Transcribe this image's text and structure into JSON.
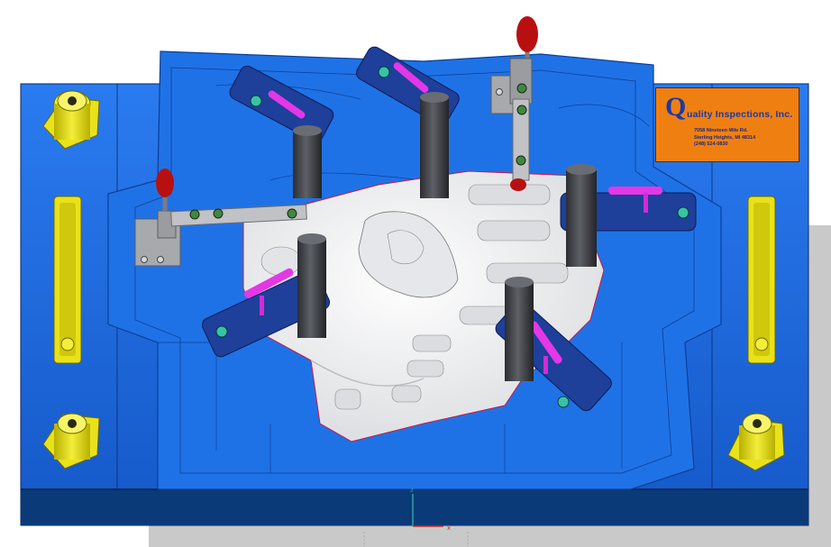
{
  "scene": {
    "colors": {
      "fixture_blue": "#1d6fe3",
      "fixture_dark_blue": "#0b3f99",
      "base_navy": "#0a3a78",
      "part_white": "#f4f4f6",
      "clamp_arm": "#1e3f9a",
      "post_gray": "#4a4d52",
      "pin_magenta": "#e437e6",
      "handle_red": "#b81010",
      "locator_yellow": "#e9e21a",
      "logo_orange": "#f07f12"
    }
  },
  "logo": {
    "q_letter": "Q",
    "company": "uality Inspections, Inc.",
    "address_line1": "7058 Nineteen Mile Rd.",
    "address_line2": "Sterling Heights, MI 48314",
    "phone": "(248) 524-0830"
  },
  "axis": {
    "z_label": "z",
    "x_label": "x"
  }
}
